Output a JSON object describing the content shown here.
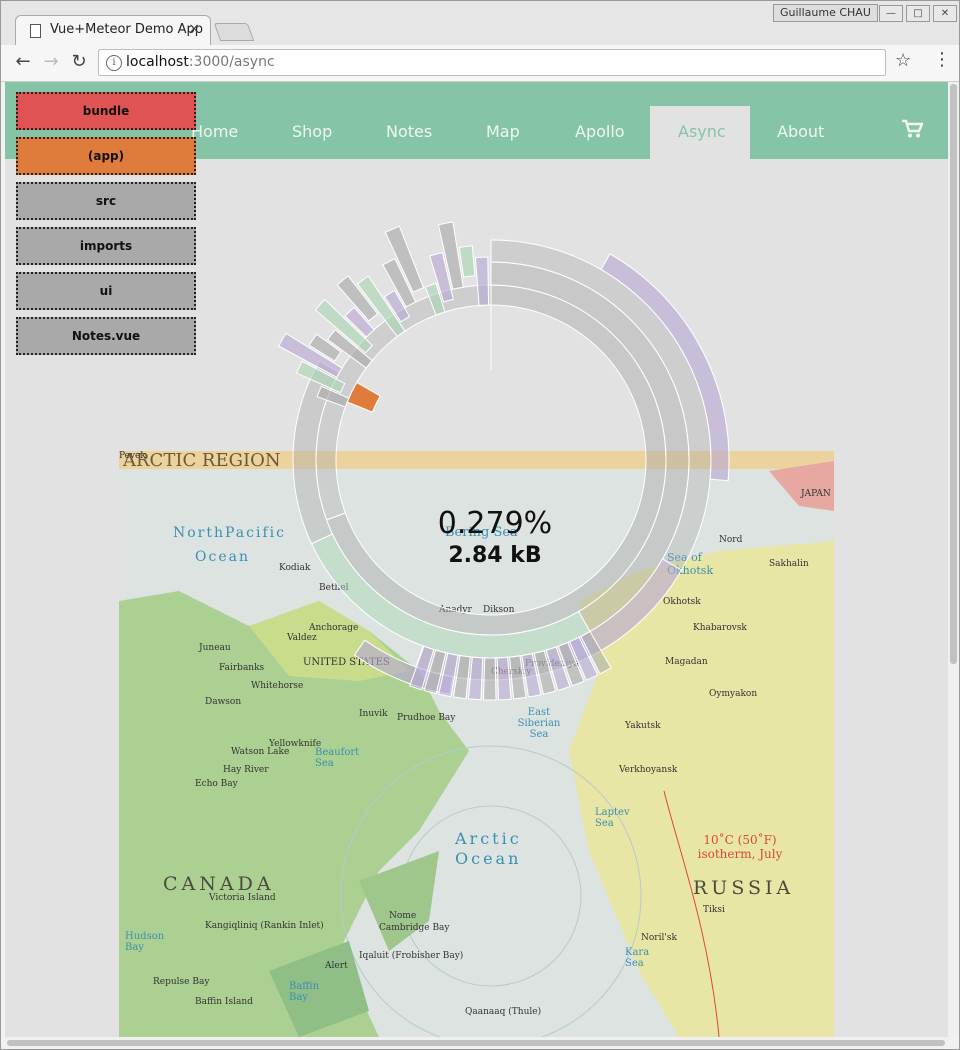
{
  "browser": {
    "tab_title": "Vue+Meteor Demo App",
    "tab_close": "×",
    "user": "Guillaume CHAU",
    "url_host": "localhost",
    "url_path": ":3000/async",
    "info_glyph": "i",
    "win_min": "—",
    "win_max": "□",
    "win_close": "✕"
  },
  "nav": {
    "items": [
      "Home",
      "Shop",
      "Notes",
      "Map",
      "Apollo",
      "Async",
      "About"
    ],
    "active": "Async"
  },
  "breadcrumbs": [
    {
      "label": "bundle",
      "color": "#e05353"
    },
    {
      "label": "(app)",
      "color": "#e07c3b"
    },
    {
      "label": "src",
      "color": "#a9a9a9"
    },
    {
      "label": "imports",
      "color": "#a9a9a9"
    },
    {
      "label": "ui",
      "color": "#a9a9a9"
    },
    {
      "label": "Notes.vue",
      "color": "#a9a9a9"
    }
  ],
  "sunburst": {
    "percent": "0.279%",
    "size": "2.84 kB",
    "colors": {
      "bundle": "#e05353",
      "app": "#e07c3b",
      "node": "#a9a9a9",
      "purple": "#b8a6d6",
      "green": "#a9d6b2"
    }
  },
  "map": {
    "title": "ARCTIC REGION",
    "labels": {
      "north_pacific": "NorthPacific",
      "ocean1": "Ocean",
      "bering": "Bering Sea",
      "okhotsk": "Sea of Okhotsk",
      "beaufort": "Beaufort Sea",
      "east_siberian": "East Siberian Sea",
      "arctic": "Arctic",
      "arctic_ocean": "Ocean",
      "laptev": "Laptev Sea",
      "kara": "Kara Sea",
      "canada": "CANADA",
      "russia": "RUSSIA",
      "united_states": "UNITED STATES",
      "isotherm": "10˚C (50˚F) isotherm, July",
      "japan": "JAPAN",
      "hudson": "Hudson Bay",
      "baffin": "Baffin Bay"
    },
    "cities": [
      "Kodiak",
      "Bethel",
      "Anchorage",
      "Valdez",
      "Juneau",
      "Fairbanks",
      "Whitehorse",
      "Dawson",
      "Watson Lake",
      "Hay River",
      "Echo Bay",
      "Yellowknife",
      "Inuvik",
      "Prudhoe Bay",
      "Barrow",
      "Nome",
      "Cambridge Bay",
      "Victoria Island",
      "Kangiqliniq (Rankin Inlet)",
      "Repulse Bay",
      "Baffin Island",
      "Iqaluit (Frobisher Bay)",
      "Alert",
      "Qaanaaq (Thule)",
      "Nord",
      "Sakhalin",
      "Khabarovsk",
      "Okhotsk",
      "Magadan",
      "Oymyakon",
      "Yakutsk",
      "Verkhoyansk",
      "Tiksi",
      "Noril'sk",
      "Dikson",
      "Anadyr",
      "Provideniya",
      "Cherskiy",
      "Pevek"
    ]
  }
}
